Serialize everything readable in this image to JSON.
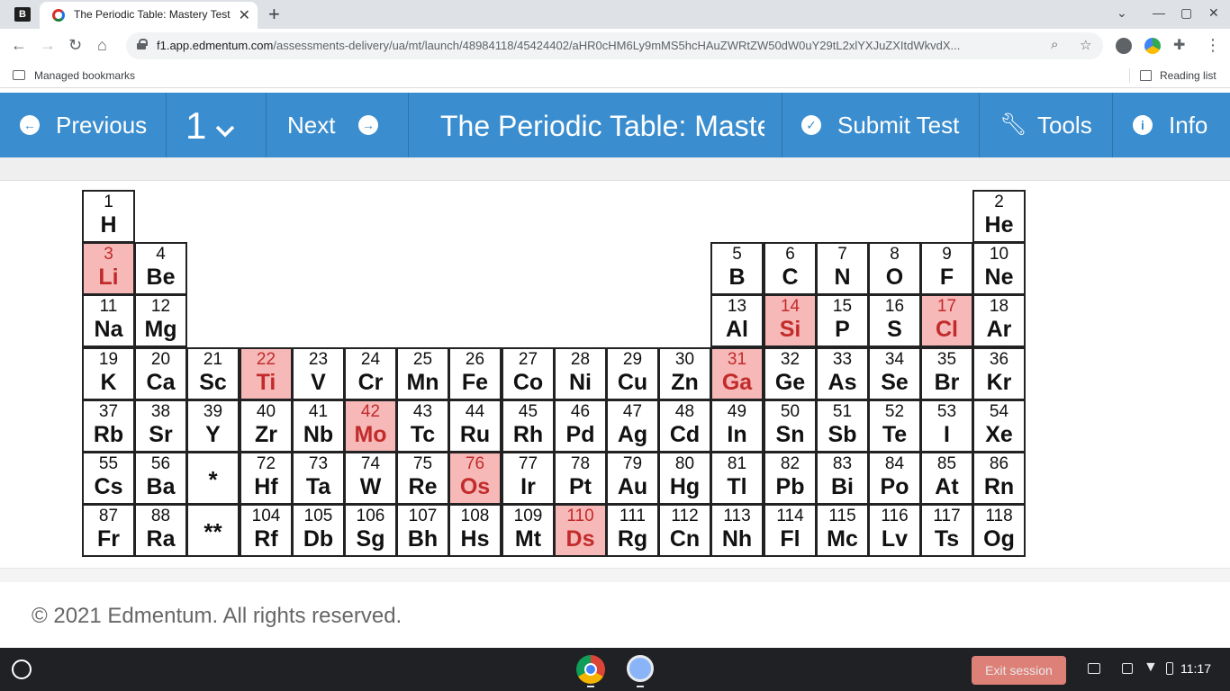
{
  "browser": {
    "tab_title": "The Periodic Table: Mastery Test",
    "url_host": "f1.app.edmentum.com",
    "url_path": "/assessments-delivery/ua/mt/launch/48984118/45424402/aHR0cHM6Ly9mMS5hcHAuZWRtZW50dW0uY29tL2xlYXJuZXItdWkvdX...",
    "bookmarks_label": "Managed bookmarks",
    "reading_list_label": "Reading list"
  },
  "toolbar": {
    "previous_label": "Previous",
    "question_number": "1",
    "next_label": "Next",
    "title": "The Periodic Table: Mastery Test",
    "submit_label": "Submit Test",
    "tools_label": "Tools",
    "info_label": "Info"
  },
  "periodic_table": {
    "highlight_color": "#f7b8b8",
    "elements": [
      {
        "n": "1",
        "s": "H",
        "r": 0,
        "c": 0
      },
      {
        "n": "2",
        "s": "He",
        "r": 0,
        "c": 17
      },
      {
        "n": "3",
        "s": "Li",
        "r": 1,
        "c": 0,
        "hl": true
      },
      {
        "n": "4",
        "s": "Be",
        "r": 1,
        "c": 1
      },
      {
        "n": "5",
        "s": "B",
        "r": 1,
        "c": 12
      },
      {
        "n": "6",
        "s": "C",
        "r": 1,
        "c": 13
      },
      {
        "n": "7",
        "s": "N",
        "r": 1,
        "c": 14
      },
      {
        "n": "8",
        "s": "O",
        "r": 1,
        "c": 15
      },
      {
        "n": "9",
        "s": "F",
        "r": 1,
        "c": 16
      },
      {
        "n": "10",
        "s": "Ne",
        "r": 1,
        "c": 17
      },
      {
        "n": "11",
        "s": "Na",
        "r": 2,
        "c": 0
      },
      {
        "n": "12",
        "s": "Mg",
        "r": 2,
        "c": 1
      },
      {
        "n": "13",
        "s": "Al",
        "r": 2,
        "c": 12
      },
      {
        "n": "14",
        "s": "Si",
        "r": 2,
        "c": 13,
        "hl": true
      },
      {
        "n": "15",
        "s": "P",
        "r": 2,
        "c": 14
      },
      {
        "n": "16",
        "s": "S",
        "r": 2,
        "c": 15
      },
      {
        "n": "17",
        "s": "Cl",
        "r": 2,
        "c": 16,
        "hl": true
      },
      {
        "n": "18",
        "s": "Ar",
        "r": 2,
        "c": 17
      },
      {
        "n": "19",
        "s": "K",
        "r": 3,
        "c": 0
      },
      {
        "n": "20",
        "s": "Ca",
        "r": 3,
        "c": 1
      },
      {
        "n": "21",
        "s": "Sc",
        "r": 3,
        "c": 2
      },
      {
        "n": "22",
        "s": "Ti",
        "r": 3,
        "c": 3,
        "hl": true
      },
      {
        "n": "23",
        "s": "V",
        "r": 3,
        "c": 4
      },
      {
        "n": "24",
        "s": "Cr",
        "r": 3,
        "c": 5
      },
      {
        "n": "25",
        "s": "Mn",
        "r": 3,
        "c": 6
      },
      {
        "n": "26",
        "s": "Fe",
        "r": 3,
        "c": 7
      },
      {
        "n": "27",
        "s": "Co",
        "r": 3,
        "c": 8
      },
      {
        "n": "28",
        "s": "Ni",
        "r": 3,
        "c": 9
      },
      {
        "n": "29",
        "s": "Cu",
        "r": 3,
        "c": 10
      },
      {
        "n": "30",
        "s": "Zn",
        "r": 3,
        "c": 11
      },
      {
        "n": "31",
        "s": "Ga",
        "r": 3,
        "c": 12,
        "hl": true
      },
      {
        "n": "32",
        "s": "Ge",
        "r": 3,
        "c": 13
      },
      {
        "n": "33",
        "s": "As",
        "r": 3,
        "c": 14
      },
      {
        "n": "34",
        "s": "Se",
        "r": 3,
        "c": 15
      },
      {
        "n": "35",
        "s": "Br",
        "r": 3,
        "c": 16
      },
      {
        "n": "36",
        "s": "Kr",
        "r": 3,
        "c": 17
      },
      {
        "n": "37",
        "s": "Rb",
        "r": 4,
        "c": 0
      },
      {
        "n": "38",
        "s": "Sr",
        "r": 4,
        "c": 1
      },
      {
        "n": "39",
        "s": "Y",
        "r": 4,
        "c": 2
      },
      {
        "n": "40",
        "s": "Zr",
        "r": 4,
        "c": 3
      },
      {
        "n": "41",
        "s": "Nb",
        "r": 4,
        "c": 4
      },
      {
        "n": "42",
        "s": "Mo",
        "r": 4,
        "c": 5,
        "hl": true
      },
      {
        "n": "43",
        "s": "Tc",
        "r": 4,
        "c": 6
      },
      {
        "n": "44",
        "s": "Ru",
        "r": 4,
        "c": 7
      },
      {
        "n": "45",
        "s": "Rh",
        "r": 4,
        "c": 8
      },
      {
        "n": "46",
        "s": "Pd",
        "r": 4,
        "c": 9
      },
      {
        "n": "47",
        "s": "Ag",
        "r": 4,
        "c": 10
      },
      {
        "n": "48",
        "s": "Cd",
        "r": 4,
        "c": 11
      },
      {
        "n": "49",
        "s": "In",
        "r": 4,
        "c": 12
      },
      {
        "n": "50",
        "s": "Sn",
        "r": 4,
        "c": 13
      },
      {
        "n": "51",
        "s": "Sb",
        "r": 4,
        "c": 14
      },
      {
        "n": "52",
        "s": "Te",
        "r": 4,
        "c": 15
      },
      {
        "n": "53",
        "s": "I",
        "r": 4,
        "c": 16
      },
      {
        "n": "54",
        "s": "Xe",
        "r": 4,
        "c": 17
      },
      {
        "n": "55",
        "s": "Cs",
        "r": 5,
        "c": 0
      },
      {
        "n": "56",
        "s": "Ba",
        "r": 5,
        "c": 1
      },
      {
        "n": "",
        "s": "*",
        "r": 5,
        "c": 2,
        "star": true
      },
      {
        "n": "72",
        "s": "Hf",
        "r": 5,
        "c": 3
      },
      {
        "n": "73",
        "s": "Ta",
        "r": 5,
        "c": 4
      },
      {
        "n": "74",
        "s": "W",
        "r": 5,
        "c": 5
      },
      {
        "n": "75",
        "s": "Re",
        "r": 5,
        "c": 6
      },
      {
        "n": "76",
        "s": "Os",
        "r": 5,
        "c": 7,
        "hl": true
      },
      {
        "n": "77",
        "s": "Ir",
        "r": 5,
        "c": 8
      },
      {
        "n": "78",
        "s": "Pt",
        "r": 5,
        "c": 9
      },
      {
        "n": "79",
        "s": "Au",
        "r": 5,
        "c": 10
      },
      {
        "n": "80",
        "s": "Hg",
        "r": 5,
        "c": 11
      },
      {
        "n": "81",
        "s": "Tl",
        "r": 5,
        "c": 12
      },
      {
        "n": "82",
        "s": "Pb",
        "r": 5,
        "c": 13
      },
      {
        "n": "83",
        "s": "Bi",
        "r": 5,
        "c": 14
      },
      {
        "n": "84",
        "s": "Po",
        "r": 5,
        "c": 15
      },
      {
        "n": "85",
        "s": "At",
        "r": 5,
        "c": 16
      },
      {
        "n": "86",
        "s": "Rn",
        "r": 5,
        "c": 17
      },
      {
        "n": "87",
        "s": "Fr",
        "r": 6,
        "c": 0
      },
      {
        "n": "88",
        "s": "Ra",
        "r": 6,
        "c": 1
      },
      {
        "n": "",
        "s": "**",
        "r": 6,
        "c": 2,
        "star": true
      },
      {
        "n": "104",
        "s": "Rf",
        "r": 6,
        "c": 3
      },
      {
        "n": "105",
        "s": "Db",
        "r": 6,
        "c": 4
      },
      {
        "n": "106",
        "s": "Sg",
        "r": 6,
        "c": 5
      },
      {
        "n": "107",
        "s": "Bh",
        "r": 6,
        "c": 6
      },
      {
        "n": "108",
        "s": "Hs",
        "r": 6,
        "c": 7
      },
      {
        "n": "109",
        "s": "Mt",
        "r": 6,
        "c": 8
      },
      {
        "n": "110",
        "s": "Ds",
        "r": 6,
        "c": 9,
        "hl": true
      },
      {
        "n": "111",
        "s": "Rg",
        "r": 6,
        "c": 10
      },
      {
        "n": "112",
        "s": "Cn",
        "r": 6,
        "c": 11
      },
      {
        "n": "113",
        "s": "Nh",
        "r": 6,
        "c": 12
      },
      {
        "n": "114",
        "s": "Fl",
        "r": 6,
        "c": 13
      },
      {
        "n": "115",
        "s": "Mc",
        "r": 6,
        "c": 14
      },
      {
        "n": "116",
        "s": "Lv",
        "r": 6,
        "c": 15
      },
      {
        "n": "117",
        "s": "Ts",
        "r": 6,
        "c": 16
      },
      {
        "n": "118",
        "s": "Og",
        "r": 6,
        "c": 17
      }
    ]
  },
  "footer": {
    "copyright": "© 2021 Edmentum. All rights reserved."
  },
  "taskbar": {
    "exit_label": "Exit session",
    "time": "11:17"
  },
  "colors": {
    "header_blue": "#3a8dcf",
    "highlight": "#f7b8b8",
    "exit_button": "#f28b82"
  }
}
